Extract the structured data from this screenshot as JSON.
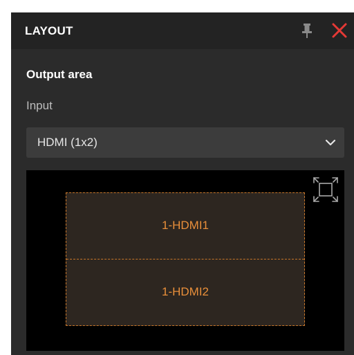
{
  "panel": {
    "title": "LAYOUT"
  },
  "output": {
    "section_title": "Output area",
    "input_label": "Input",
    "input_selected": "HDMI (1x2)"
  },
  "layout": {
    "windows": [
      {
        "label": "1-HDMI1"
      },
      {
        "label": "1-HDMI2"
      }
    ]
  },
  "colors": {
    "accent": "#e98f3a",
    "close": "#e53935",
    "panel_bg": "#2b2b2b",
    "header_bg": "#232323"
  },
  "icons": {
    "pin": "pin-icon",
    "close": "close-icon",
    "dropdown": "chevron-down-icon",
    "fullscreen": "fullscreen-icon"
  }
}
